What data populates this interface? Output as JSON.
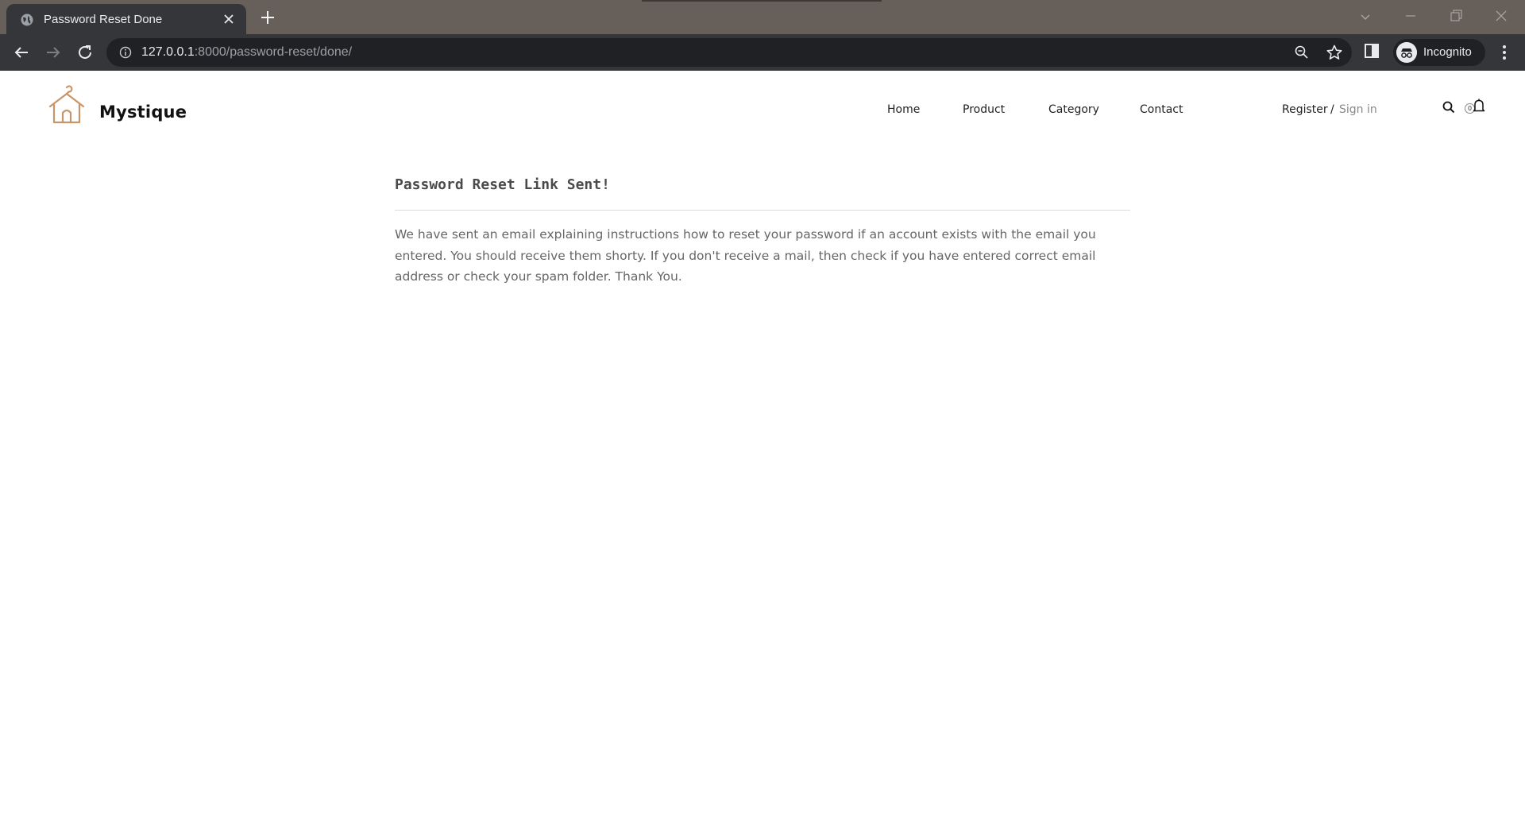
{
  "browser": {
    "tab_title": "Password Reset Done",
    "url_host": "127.0.0.1",
    "url_rest": ":8000/password-reset/done/",
    "profile_label": "Incognito"
  },
  "site": {
    "brand": "Mystique",
    "nav": [
      {
        "label": "Home"
      },
      {
        "label": "Product"
      },
      {
        "label": "Category"
      },
      {
        "label": "Contact"
      }
    ],
    "auth": {
      "register": "Register",
      "separator": "/",
      "signin": "Sign in"
    },
    "cart_count": "0",
    "accent_color": "#c8956a"
  },
  "content": {
    "title": "Password Reset Link Sent!",
    "message": "We have sent an email explaining instructions how to reset your password if an account exists with the email you entered. You should receive them shorty. If you don't receive a mail, then check if you have entered correct email address or check your spam folder. Thank You."
  },
  "icons": [
    "globe-icon",
    "close-icon",
    "plus-icon",
    "chevron-down-icon",
    "minimize-icon",
    "restore-icon",
    "back-icon",
    "forward-icon",
    "reload-icon",
    "info-icon",
    "zoom-out-icon",
    "star-icon",
    "side-panel-icon",
    "incognito-icon",
    "kebab-menu-icon",
    "hanger-house-logo-icon",
    "search-icon",
    "bell-icon"
  ]
}
